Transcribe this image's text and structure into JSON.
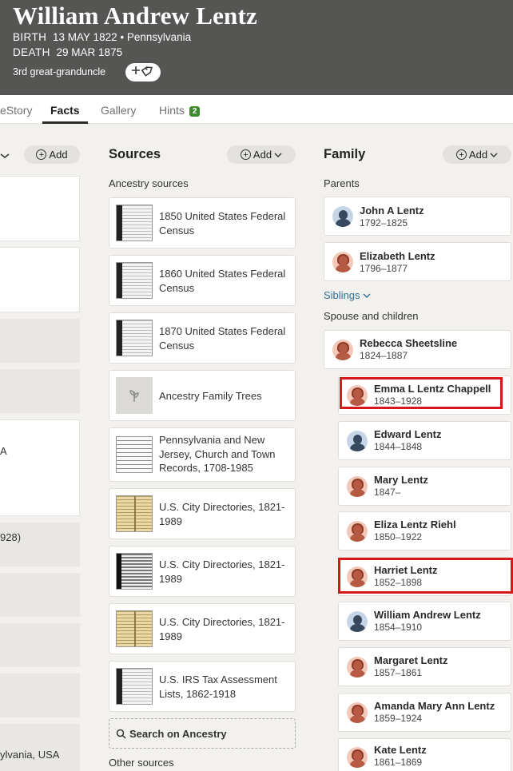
{
  "header": {
    "name": "William Andrew Lentz",
    "birth_label": "BIRTH",
    "birth_value": "13 MAY 1822 • Pennsylvania",
    "death_label": "DEATH",
    "death_value": "29 MAR 1875",
    "relationship": "3rd great-granduncle",
    "tag_icon": "plus-tag-icon"
  },
  "tabs": {
    "lifestory": "eStory",
    "facts": "Facts",
    "gallery": "Gallery",
    "hints": "Hints",
    "hints_count": "2"
  },
  "facts": {
    "add_label": "Add",
    "text_a": "A",
    "text_928": "928)",
    "text_place": "ylvania, USA"
  },
  "sources": {
    "title": "Sources",
    "add_label": "Add",
    "ancestry_heading": "Ancestry sources",
    "items": [
      {
        "label": "1850 United States Federal Census"
      },
      {
        "label": "1860 United States Federal Census"
      },
      {
        "label": "1870 United States Federal Census"
      },
      {
        "label": "Ancestry Family Trees"
      },
      {
        "label": "Pennsylvania and New Jersey, Church and Town Records, 1708-1985"
      },
      {
        "label": "U.S. City Directories, 1821-1989"
      },
      {
        "label": "U.S. City Directories, 1821-1989"
      },
      {
        "label": "U.S. City Directories, 1821-1989"
      },
      {
        "label": "U.S. IRS Tax Assessment Lists, 1862-1918"
      }
    ],
    "search_label": "Search on Ancestry",
    "other_heading": "Other sources"
  },
  "family": {
    "title": "Family",
    "add_label": "Add",
    "parents_heading": "Parents",
    "parents": [
      {
        "name": "John A Lentz",
        "years": "1792–1825"
      },
      {
        "name": "Elizabeth Lentz",
        "years": "1796–1877"
      }
    ],
    "siblings_label": "Siblings",
    "spouse_heading": "Spouse and children",
    "spouse": {
      "name": "Rebecca Sheetsline",
      "years": "1824–1887"
    },
    "children": [
      {
        "name": "Emma L Lentz Chappell",
        "years": "1843–1928"
      },
      {
        "name": "Edward Lentz",
        "years": "1844–1848"
      },
      {
        "name": "Mary Lentz",
        "years": "1847–"
      },
      {
        "name": "Eliza Lentz Riehl",
        "years": "1850–1922"
      },
      {
        "name": "Harriet Lentz",
        "years": "1852–1898"
      },
      {
        "name": "William Andrew Lentz",
        "years": "1854–1910"
      },
      {
        "name": "Margaret Lentz",
        "years": "1857–1861"
      },
      {
        "name": "Amanda Mary Ann Lentz",
        "years": "1859–1924"
      },
      {
        "name": "Kate Lentz",
        "years": "1861–1869"
      }
    ]
  },
  "colors": {
    "header_bg": "#555553",
    "highlight": "#d8171b",
    "hint_badge": "#3d8a2f",
    "link": "#2f6f95"
  }
}
